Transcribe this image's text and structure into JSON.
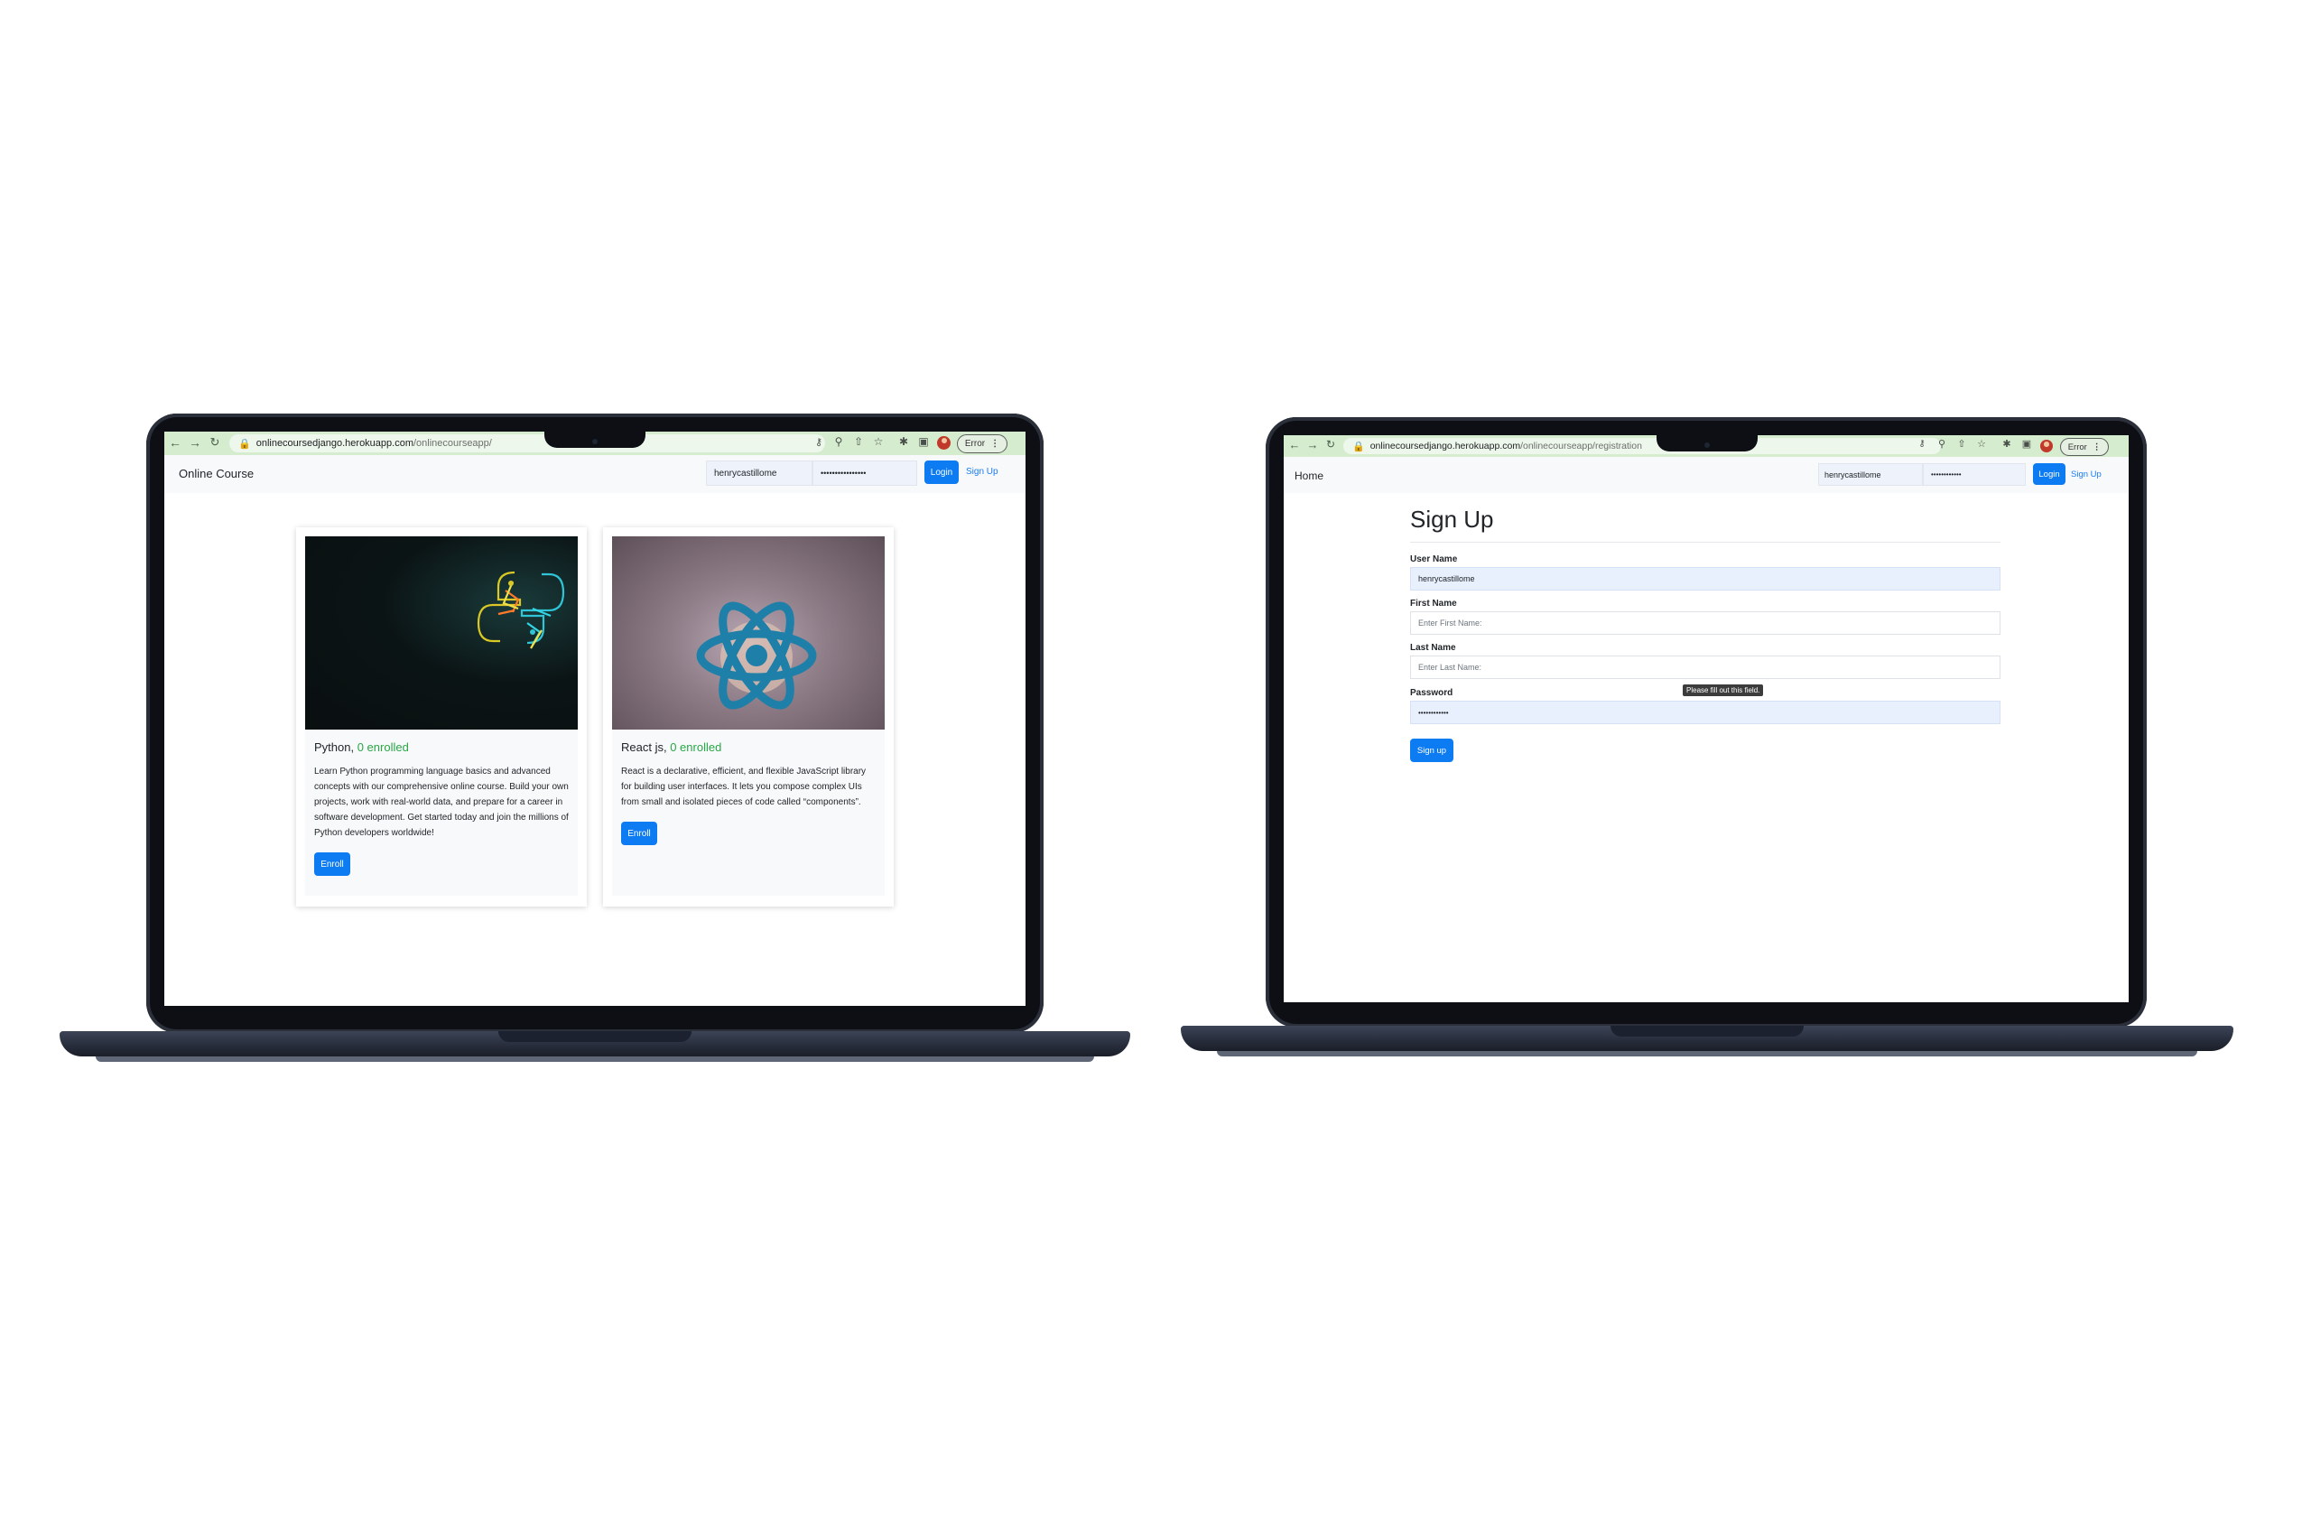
{
  "left": {
    "browser": {
      "url_host": "onlinecoursedjango.herokuapp.com",
      "url_path": "/onlinecourseapp/",
      "profile_status": "Error"
    },
    "navbar": {
      "brand": "Online Course",
      "username_value": "henrycastillome",
      "password_value": "••••••••••••••••",
      "login_label": "Login",
      "signup_label": "Sign Up"
    },
    "courses": [
      {
        "name": "Python,",
        "enrolled": "0 enrolled",
        "description": "Learn Python programming language basics and advanced concepts with our comprehensive online course. Build your own projects, work with real-world data, and prepare for a career in software development. Get started today and join the millions of Python developers worldwide!",
        "button": "Enroll"
      },
      {
        "name": "React js,",
        "enrolled": "0 enrolled",
        "description": "React is a declarative, efficient, and flexible JavaScript library for building user interfaces. It lets you compose complex UIs from small and isolated pieces of code called “components”.",
        "button": "Enroll"
      }
    ]
  },
  "right": {
    "browser": {
      "url_host": "onlinecoursedjango.herokuapp.com",
      "url_path": "/onlinecourseapp/registration",
      "profile_status": "Error"
    },
    "navbar": {
      "brand": "Home",
      "username_value": "henrycastillome",
      "password_value": "••••••••••••",
      "login_label": "Login",
      "signup_label": "Sign Up"
    },
    "form": {
      "title": "Sign Up",
      "username_label": "User Name",
      "username_value": "henrycastillome",
      "firstname_label": "First Name",
      "firstname_placeholder": "Enter First Name:",
      "lastname_label": "Last Name",
      "lastname_placeholder": "Enter Last Name:",
      "password_label": "Password",
      "password_value": "••••••••••••",
      "tooltip": "Please fill out this field.",
      "submit_label": "Sign up"
    }
  },
  "colors": {
    "primary": "#0d7bf2",
    "success": "#28a745",
    "chrome_bar": "#d5eccf",
    "laptop_body": "#0d0f14"
  },
  "icons": [
    "back-arrow-icon",
    "forward-arrow-icon",
    "reload-icon",
    "lock-icon",
    "key-icon",
    "zoom-icon",
    "share-icon",
    "star-icon",
    "extensions-icon",
    "sidepanel-icon",
    "more-icon"
  ]
}
